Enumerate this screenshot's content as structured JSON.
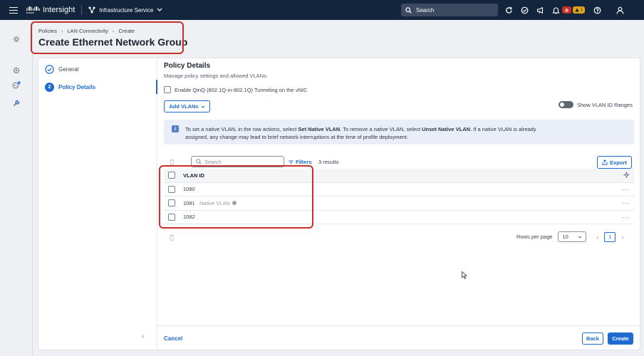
{
  "topbar": {
    "cisco_word": "cisco",
    "brand": "Intersight",
    "service": "Infrastructure Service",
    "search_label": "Search",
    "alarm_critical_count": "",
    "alarm_warning_count": "1"
  },
  "breadcrumb": [
    "Policies",
    "LAN Connectivity",
    "Create"
  ],
  "page_title": "Create Ethernet Network Group",
  "steps": [
    {
      "label": "General",
      "state": "complete"
    },
    {
      "label": "Policy Details",
      "number": "2",
      "state": "active"
    }
  ],
  "policy": {
    "title": "Policy Details",
    "subtitle": "Manage policy settings and allowed VLANs.",
    "qinq_label": "Enable QinQ (802.1Q-in-802.1Q) Tunneling on the vNIC",
    "add_vlans": "Add VLANs",
    "show_ranges": "Show VLAN ID Ranges"
  },
  "info": {
    "icon": "i",
    "p1": "To set a native VLAN, in the row actions, select ",
    "b1": "Set Native VLAN",
    "p2": ". To remove a native VLAN, select ",
    "b2": "Unset Native VLAN",
    "p3": ". If a native VLAN is already assigned, any change may lead to brief network interruptions at the time of profile deployment."
  },
  "table": {
    "search_placeholder": "Search",
    "filters": "Filters",
    "results": "3 results",
    "export": "Export",
    "column": "VLAN ID",
    "rows": [
      {
        "id": "1080",
        "tag": ""
      },
      {
        "id": "1081",
        "tag": "Native VLAN"
      },
      {
        "id": "1082",
        "tag": ""
      }
    ]
  },
  "pager": {
    "rows_per_page_label": "Rows per page",
    "rows_per_page": "10",
    "page": "1"
  },
  "footer": {
    "cancel": "Cancel",
    "back": "Back",
    "create": "Create"
  },
  "colors": {
    "topbar": "#13253d",
    "accent": "#1e6ad3",
    "highlight": "#c9302a"
  }
}
